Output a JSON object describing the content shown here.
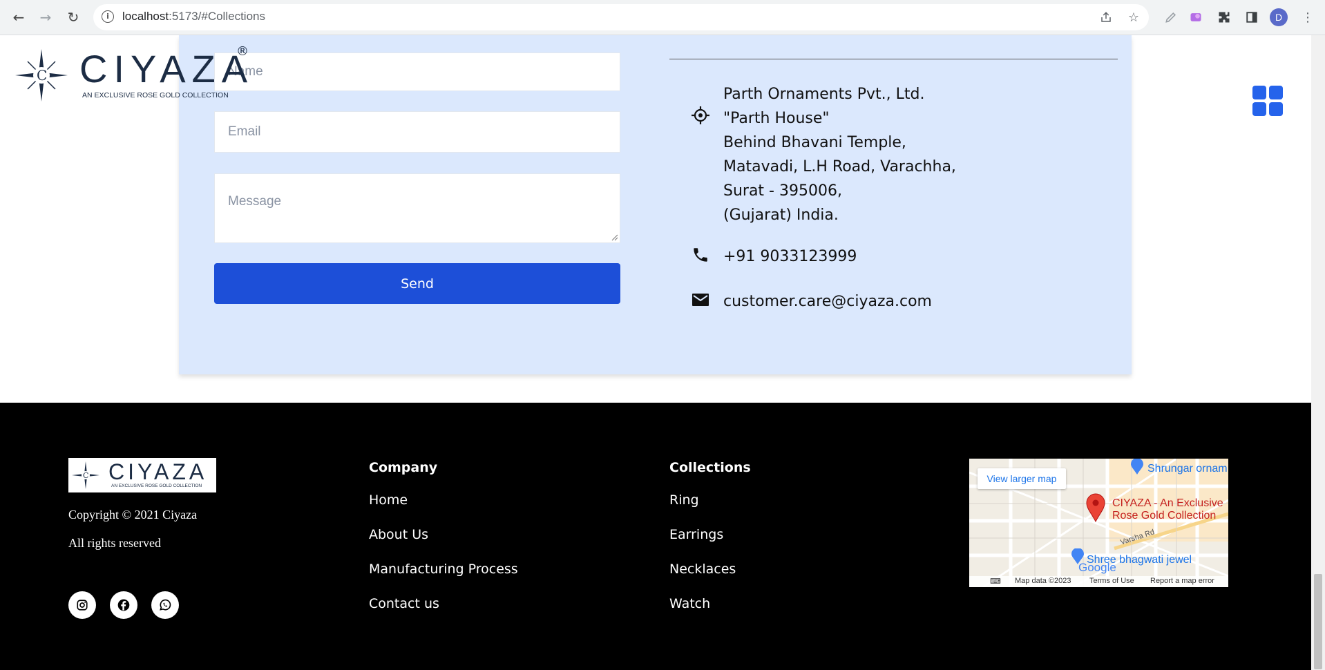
{
  "browser": {
    "url_host": "localhost",
    "url_rest": ":5173/#Collections",
    "profile_initial": "D"
  },
  "brand": {
    "name": "CIYAZA",
    "tagline": "AN EXCLUSIVE ROSE GOLD COLLECTION",
    "registered": "®"
  },
  "form": {
    "name_placeholder": "Name",
    "email_placeholder": "Email",
    "message_placeholder": "Message",
    "send_label": "Send"
  },
  "contact": {
    "address_lines": [
      "Parth Ornaments Pvt., Ltd.",
      "\"Parth House\"",
      "Behind Bhavani Temple,",
      "Matavadi, L.H Road, Varachha,",
      "Surat - 395006,",
      "(Gujarat) India."
    ],
    "phone": "+91 9033123999",
    "email": "customer.care@ciyaza.com"
  },
  "footer": {
    "copyright": "Copyright © 2021 Ciyaza",
    "rights": "All rights reserved",
    "company_heading": "Company",
    "company_links": [
      "Home",
      "About Us",
      "Manufacturing Process",
      "Contact us"
    ],
    "collections_heading": "Collections",
    "collections_links": [
      "Ring",
      "Earrings",
      "Necklaces",
      "Watch"
    ],
    "social_icons": [
      "instagram-icon",
      "facebook-icon",
      "whatsapp-icon"
    ]
  },
  "map": {
    "view_larger": "View larger map",
    "place_name_line1": "CIYAZA - An Exclusive",
    "place_name_line2": "Rose Gold Collection",
    "poi_top": "Shrungar ornam",
    "poi_bottom": "Shree bhagwati jewel",
    "road": "Varsha Rd",
    "footer_data": "Map data ©2023",
    "footer_terms": "Terms of Use",
    "footer_report": "Report a map error",
    "google": "Google"
  },
  "colors": {
    "accent": "#1d4fd8",
    "panel": "#dbe8fd",
    "footer_bg": "#000000"
  }
}
